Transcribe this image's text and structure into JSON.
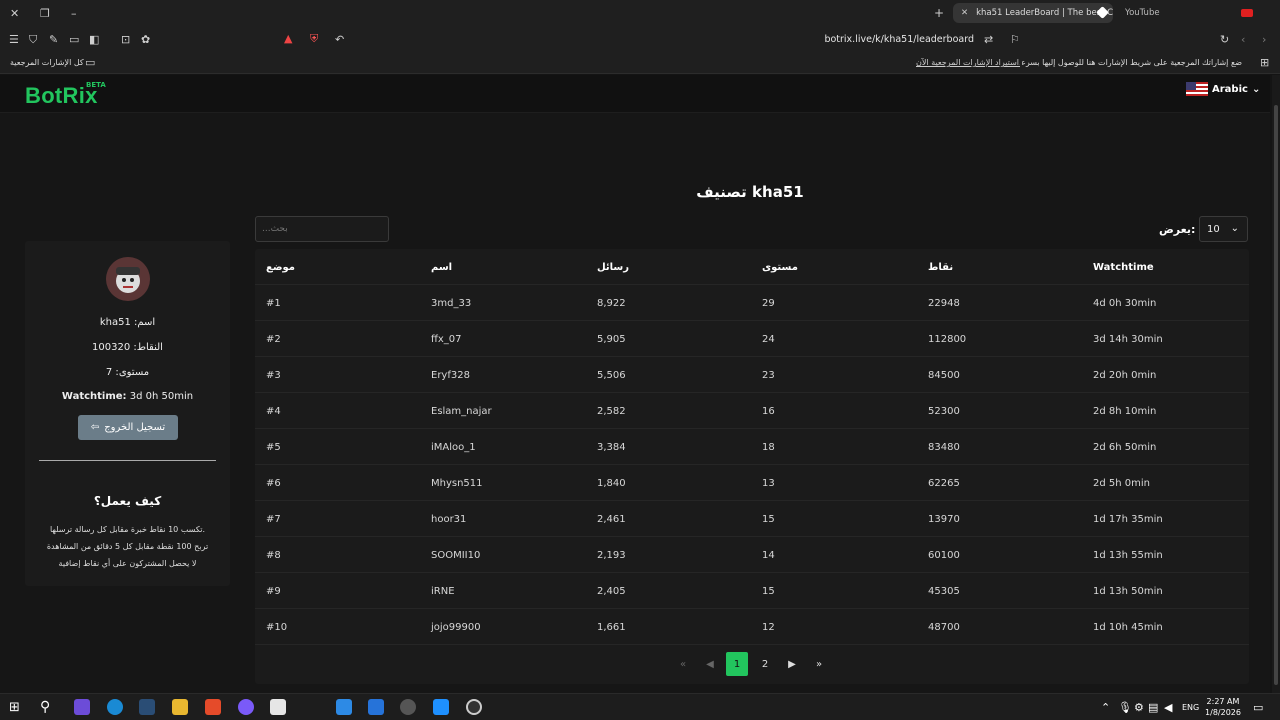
{
  "browser": {
    "tabs": [
      {
        "label": "kha51 LeaderBoard | The best Cl",
        "active": true
      },
      {
        "label": "YouTube",
        "active": false
      }
    ],
    "url": "botrix.live/k/kha51/leaderboard",
    "bookmarks_bar": {
      "all_bookmarks": "كل الإشارات المرجعية",
      "hint": "ضع إشاراتك المرجعية على شريط الإشارات هنا للوصول إليها بسرعة.",
      "import_link": "استيراد الإشارات المرجعية الآن..."
    }
  },
  "header": {
    "logo": "BotRix",
    "beta": "BETA",
    "language": "Arabic"
  },
  "main": {
    "title": "تصنيف kha51",
    "search_placeholder": "...بحث",
    "show_label": "يعرض:",
    "show_value": "10"
  },
  "table": {
    "headers": [
      "موضع",
      "اسم",
      "رسائل",
      "مستوى",
      "نقاط",
      "Watchtime"
    ],
    "rows": [
      [
        "#1",
        "3md_33",
        "8,922",
        "29",
        "22948",
        "4d 0h 30min"
      ],
      [
        "#2",
        "ffx_07",
        "5,905",
        "24",
        "112800",
        "3d 14h 30min"
      ],
      [
        "#3",
        "Eryf328",
        "5,506",
        "23",
        "84500",
        "2d 20h 0min"
      ],
      [
        "#4",
        "Eslam_najar",
        "2,582",
        "16",
        "52300",
        "2d 8h 10min"
      ],
      [
        "#5",
        "iMAloo_1",
        "3,384",
        "18",
        "83480",
        "2d 6h 50min"
      ],
      [
        "#6",
        "Mhysn511",
        "1,840",
        "13",
        "62265",
        "2d 5h 0min"
      ],
      [
        "#7",
        "hoor31",
        "2,461",
        "15",
        "13970",
        "1d 17h 35min"
      ],
      [
        "#8",
        "SOOMII10",
        "2,193",
        "14",
        "60100",
        "1d 13h 55min"
      ],
      [
        "#9",
        "iRNE",
        "2,405",
        "15",
        "45305",
        "1d 13h 50min"
      ],
      [
        "#10",
        "jojo99900",
        "1,661",
        "12",
        "48700",
        "1d 10h 45min"
      ]
    ],
    "pagination": {
      "pages": [
        "1",
        "2"
      ],
      "current": "1"
    }
  },
  "profile": {
    "name": "kha51 :اسم",
    "points": "100320 :النقاط",
    "level": "7 :مستوى",
    "watchtime_label": "Watchtime:",
    "watchtime_value": "3d 0h 50min",
    "logout": "تسجيل الخروج"
  },
  "how": {
    "title": "كيف يعمل؟",
    "rules": [
      "تكسب 10 نقاط خبرة مقابل كل رسالة ترسلها.",
      "تربح 100 نقطة مقابل كل 5 دقائق من المشاهدة",
      "لا يحصل المشتركون على أي نقاط إضافية"
    ]
  },
  "taskbar": {
    "lang": "ENG",
    "time": "2:27 AM",
    "date": "1/8/2026"
  },
  "colors": {
    "accent": "#22c55e",
    "background": "#161616",
    "panel": "#1b1b1b"
  }
}
